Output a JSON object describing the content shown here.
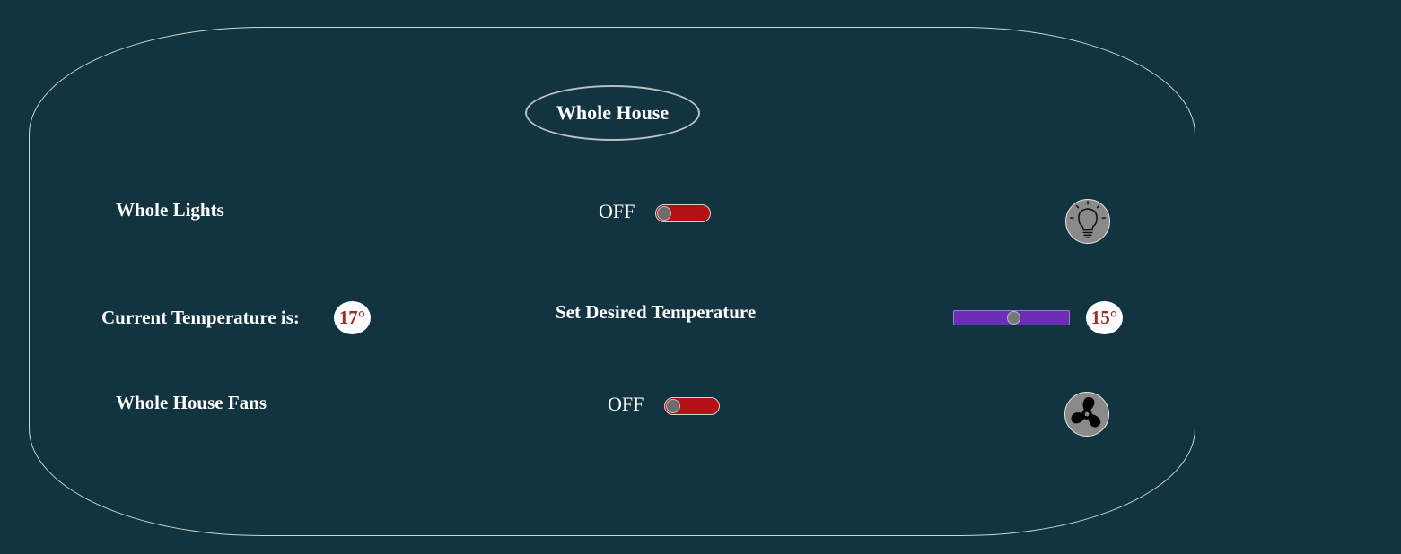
{
  "panel": {
    "title": "Whole House"
  },
  "lights": {
    "label": "Whole Lights",
    "state": "OFF",
    "icon": "lightbulb-icon"
  },
  "temperature": {
    "current_label": "Current Temperature is:",
    "current_value": "17°",
    "desired_label": "Set Desired Temperature",
    "desired_value": "15°",
    "slider_fraction": 0.52
  },
  "fans": {
    "label": "Whole House Fans",
    "state": "OFF",
    "icon": "fan-icon"
  },
  "colors": {
    "background": "#123440",
    "toggle_off": "#b51114",
    "slider_track": "#6a2fb5",
    "temp_text": "#9b2f2f"
  }
}
